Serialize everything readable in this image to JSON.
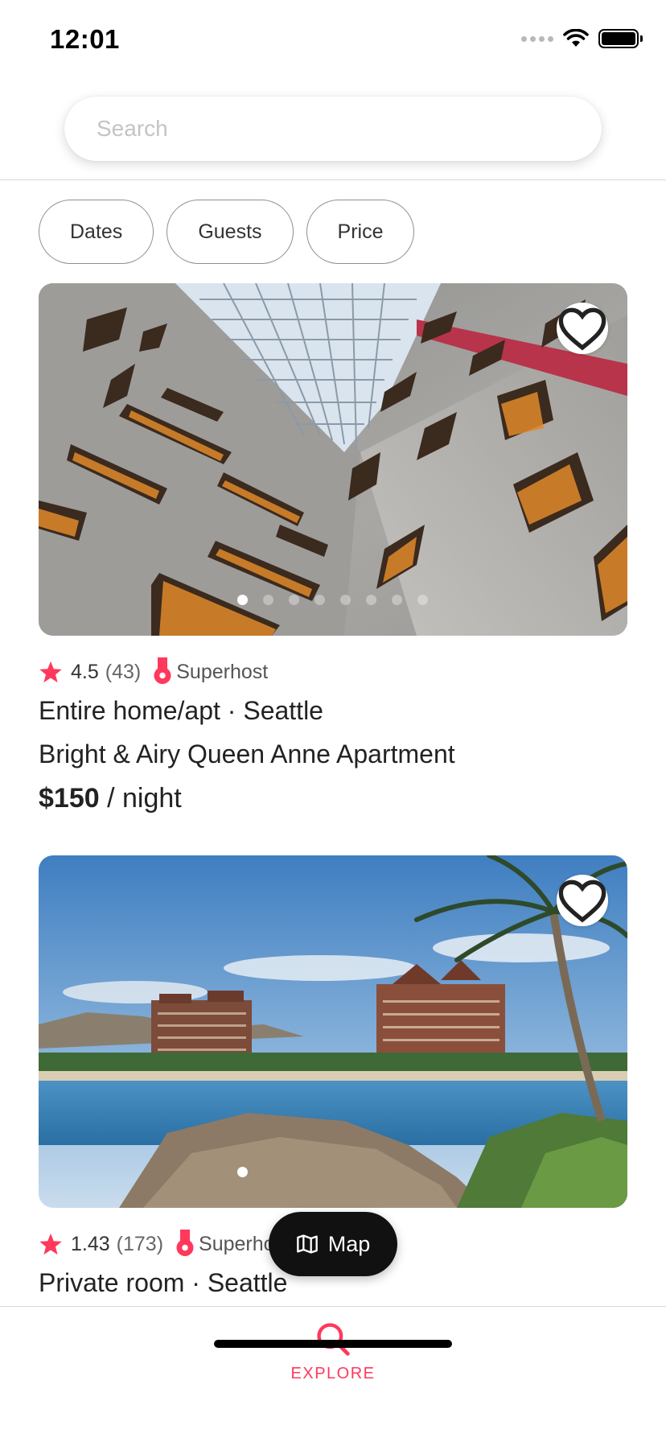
{
  "status_bar": {
    "time": "12:01"
  },
  "search": {
    "placeholder": "Search",
    "value": ""
  },
  "filters": [
    {
      "label": "Dates"
    },
    {
      "label": "Guests"
    },
    {
      "label": "Price"
    }
  ],
  "listings": [
    {
      "rating": "4.5",
      "review_count": "(43)",
      "badge": "Superhost",
      "type_location": "Entire home/apt · Seattle",
      "title": "Bright & Airy Queen Anne Apartment",
      "price": "$150",
      "price_unit": " / night",
      "photo_count": 8,
      "active_photo": 1
    },
    {
      "rating": "1.43",
      "review_count": "(173)",
      "badge": "Superhost",
      "type_location": "Private room · Seattle",
      "photo_count": 1,
      "active_photo": 1
    }
  ],
  "map_button": {
    "label": "Map"
  },
  "tab_bar": {
    "explore_label": "EXPLORE"
  },
  "colors": {
    "accent": "#ff385c",
    "text": "#222222",
    "map_button_bg": "#111111"
  }
}
